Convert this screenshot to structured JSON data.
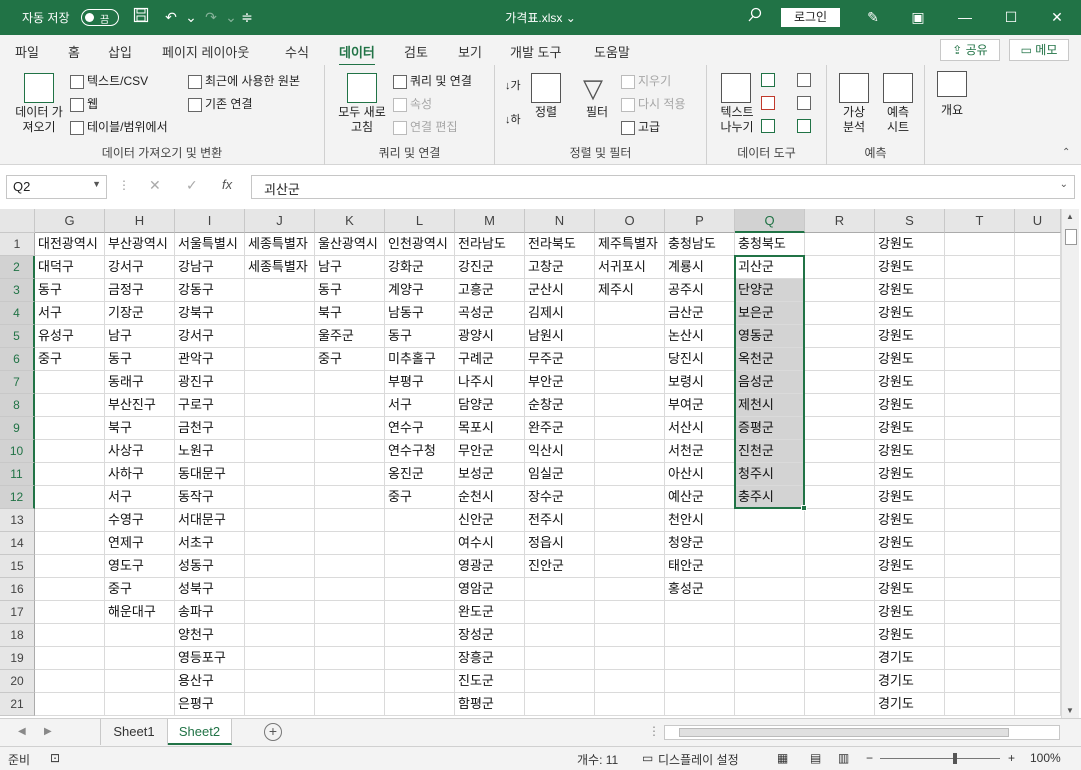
{
  "titlebar": {
    "autosave_label": "자동 저장",
    "autosave_state": "끔",
    "doc_title": "가격표.xlsx  ⌄",
    "login_label": "로그인",
    "icons": [
      "save-icon",
      "undo-icon",
      "redo-icon",
      "customize-icon",
      "search-icon",
      "pen-icon",
      "ribbon-display-icon",
      "minimize-icon",
      "maximize-icon",
      "close-icon"
    ]
  },
  "menu": {
    "tabs": [
      "파일",
      "홈",
      "삽입",
      "페이지 레이아웃",
      "수식",
      "데이터",
      "검토",
      "보기",
      "개발 도구",
      "도움말"
    ],
    "active": "데이터",
    "share_label": "공유",
    "memo_label": "메모"
  },
  "ribbon": {
    "groups": {
      "get_data": {
        "label": "데이터 가져오기 및 변환",
        "get_data_btn": "데이터 가\n져오기",
        "text_csv": "텍스트/CSV",
        "web": "웹",
        "table_range": "테이블/범위에서",
        "recent_sources": "최근에 사용한 원본",
        "existing_conn": "기존 연결"
      },
      "queries": {
        "label": "쿼리 및 연결",
        "refresh_all": "모두 새로\n고침",
        "queries_conn": "쿼리 및 연결",
        "properties": "속성",
        "edit_links": "연결 편집"
      },
      "sort_filter": {
        "label": "정렬 및 필터",
        "sort": "정렬",
        "filter": "필터",
        "clear": "지우기",
        "reapply": "다시 적용",
        "advanced": "고급"
      },
      "data_tools": {
        "label": "데이터 도구",
        "text_to_columns": "텍스트\n나누기"
      },
      "forecast": {
        "label": "예측",
        "what_if": "가상\n분석",
        "forecast_sheet": "예측\n시트"
      },
      "outline": {
        "label": "개요"
      }
    }
  },
  "formula_bar": {
    "name_box": "Q2",
    "fx": "fx",
    "value": "괴산군"
  },
  "grid": {
    "columns": [
      "G",
      "H",
      "I",
      "J",
      "K",
      "L",
      "M",
      "N",
      "O",
      "P",
      "Q",
      "R",
      "S",
      "T",
      "U"
    ],
    "selected_column": "Q",
    "rows": [
      "1",
      "2",
      "3",
      "4",
      "5",
      "6",
      "7",
      "8",
      "9",
      "10",
      "11",
      "12",
      "13",
      "14",
      "15",
      "16",
      "17",
      "18",
      "19",
      "20",
      "21"
    ],
    "selected_rows": [
      "2",
      "3",
      "4",
      "5",
      "6",
      "7",
      "8",
      "9",
      "10",
      "11",
      "12"
    ],
    "active_cell": "Q2",
    "selection_range": "Q2:Q12",
    "cells": [
      [
        "대전광역시",
        "부산광역시",
        "서울특별시",
        "세종특별자",
        "울산광역시",
        "인천광역시",
        "전라남도",
        "전라북도",
        "제주특별자",
        "충청남도",
        "충청북도",
        "",
        "강원도",
        "",
        ""
      ],
      [
        "대덕구",
        "강서구",
        "강남구",
        "세종특별자",
        "남구",
        "강화군",
        "강진군",
        "고창군",
        "서귀포시",
        "계룡시",
        "괴산군",
        "",
        "강원도",
        "",
        ""
      ],
      [
        "동구",
        "금정구",
        "강동구",
        "",
        "동구",
        "계양구",
        "고흥군",
        "군산시",
        "제주시",
        "공주시",
        "단양군",
        "",
        "강원도",
        "",
        ""
      ],
      [
        "서구",
        "기장군",
        "강북구",
        "",
        "북구",
        "남동구",
        "곡성군",
        "김제시",
        "",
        "금산군",
        "보은군",
        "",
        "강원도",
        "",
        ""
      ],
      [
        "유성구",
        "남구",
        "강서구",
        "",
        "울주군",
        "동구",
        "광양시",
        "남원시",
        "",
        "논산시",
        "영동군",
        "",
        "강원도",
        "",
        ""
      ],
      [
        "중구",
        "동구",
        "관악구",
        "",
        "중구",
        "미추홀구",
        "구례군",
        "무주군",
        "",
        "당진시",
        "옥천군",
        "",
        "강원도",
        "",
        ""
      ],
      [
        "",
        "동래구",
        "광진구",
        "",
        "",
        "부평구",
        "나주시",
        "부안군",
        "",
        "보령시",
        "음성군",
        "",
        "강원도",
        "",
        ""
      ],
      [
        "",
        "부산진구",
        "구로구",
        "",
        "",
        "서구",
        "담양군",
        "순창군",
        "",
        "부여군",
        "제천시",
        "",
        "강원도",
        "",
        ""
      ],
      [
        "",
        "북구",
        "금천구",
        "",
        "",
        "연수구",
        "목포시",
        "완주군",
        "",
        "서산시",
        "증평군",
        "",
        "강원도",
        "",
        ""
      ],
      [
        "",
        "사상구",
        "노원구",
        "",
        "",
        "연수구청",
        "무안군",
        "익산시",
        "",
        "서천군",
        "진천군",
        "",
        "강원도",
        "",
        ""
      ],
      [
        "",
        "사하구",
        "동대문구",
        "",
        "",
        "옹진군",
        "보성군",
        "임실군",
        "",
        "아산시",
        "청주시",
        "",
        "강원도",
        "",
        ""
      ],
      [
        "",
        "서구",
        "동작구",
        "",
        "",
        "중구",
        "순천시",
        "장수군",
        "",
        "예산군",
        "충주시",
        "",
        "강원도",
        "",
        ""
      ],
      [
        "",
        "수영구",
        "서대문구",
        "",
        "",
        "",
        "신안군",
        "전주시",
        "",
        "천안시",
        "",
        "",
        "강원도",
        "",
        ""
      ],
      [
        "",
        "연제구",
        "서초구",
        "",
        "",
        "",
        "여수시",
        "정읍시",
        "",
        "청양군",
        "",
        "",
        "강원도",
        "",
        ""
      ],
      [
        "",
        "영도구",
        "성동구",
        "",
        "",
        "",
        "영광군",
        "진안군",
        "",
        "태안군",
        "",
        "",
        "강원도",
        "",
        ""
      ],
      [
        "",
        "중구",
        "성북구",
        "",
        "",
        "",
        "영암군",
        "",
        "",
        "홍성군",
        "",
        "",
        "강원도",
        "",
        ""
      ],
      [
        "",
        "해운대구",
        "송파구",
        "",
        "",
        "",
        "완도군",
        "",
        "",
        "",
        "",
        "",
        "강원도",
        "",
        ""
      ],
      [
        "",
        "",
        "양천구",
        "",
        "",
        "",
        "장성군",
        "",
        "",
        "",
        "",
        "",
        "강원도",
        "",
        ""
      ],
      [
        "",
        "",
        "영등포구",
        "",
        "",
        "",
        "장흥군",
        "",
        "",
        "",
        "",
        "",
        "경기도",
        "",
        ""
      ],
      [
        "",
        "",
        "용산구",
        "",
        "",
        "",
        "진도군",
        "",
        "",
        "",
        "",
        "",
        "경기도",
        "",
        ""
      ],
      [
        "",
        "",
        "은평구",
        "",
        "",
        "",
        "함평군",
        "",
        "",
        "",
        "",
        "",
        "경기도",
        "",
        ""
      ]
    ]
  },
  "sheets": {
    "tabs": [
      "Sheet1",
      "Sheet2"
    ],
    "active": "Sheet2"
  },
  "status": {
    "ready": "준비",
    "count": "개수: 11",
    "display_settings": "디스플레이 설정",
    "zoom": "100%"
  },
  "colors": {
    "accent": "#217346",
    "selection_fill": "#d3d3d3"
  }
}
